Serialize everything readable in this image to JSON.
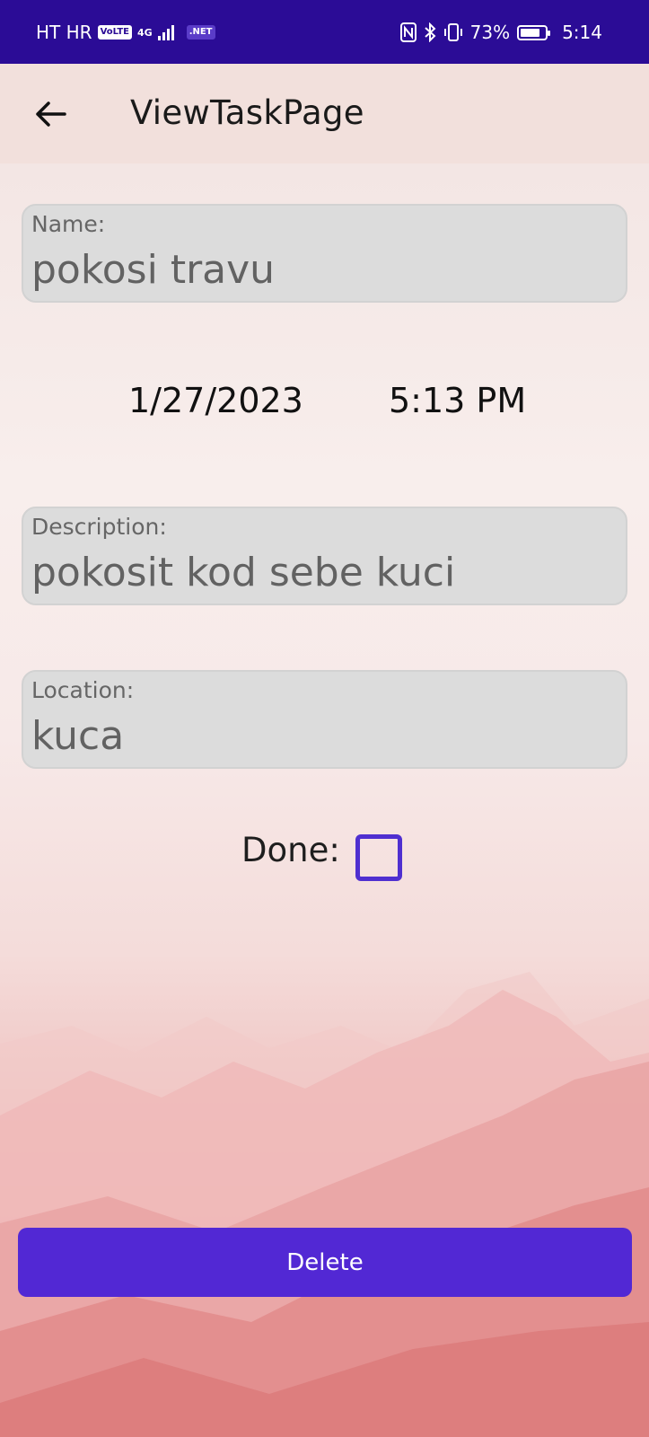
{
  "status_bar": {
    "carrier": "HT HR",
    "volte_badge": "VoLTE",
    "network_type": "4G",
    "net_badge": ".NET",
    "battery_percent": "73%",
    "time": "5:14"
  },
  "app_bar": {
    "title": "ViewTaskPage"
  },
  "form": {
    "name": {
      "label": "Name:",
      "value": "pokosi travu"
    },
    "date": "1/27/2023",
    "time": "5:13 PM",
    "description": {
      "label": "Description:",
      "value": "pokosit kod sebe kuci"
    },
    "location": {
      "label": "Location:",
      "value": "kuca"
    },
    "done": {
      "label": "Done:",
      "checked": false
    }
  },
  "actions": {
    "delete_label": "Delete"
  },
  "colors": {
    "status_bar": "#2b0c96",
    "app_bar": "#f2e0dc",
    "accent": "#5228d4",
    "checkbox": "#4f2fd0"
  }
}
